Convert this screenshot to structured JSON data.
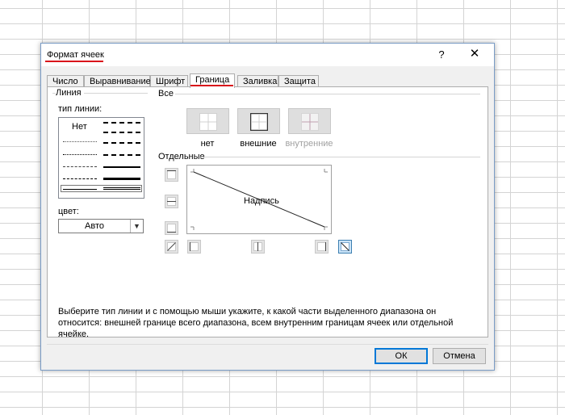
{
  "dialog": {
    "title": "Формат ячеек",
    "help_label": "?",
    "close_label": "✕"
  },
  "tabs": [
    {
      "label": "Число"
    },
    {
      "label": "Выравнивание"
    },
    {
      "label": "Шрифт"
    },
    {
      "label": "Граница"
    },
    {
      "label": "Заливка"
    },
    {
      "label": "Защита"
    }
  ],
  "active_tab": "Граница",
  "line": {
    "group_label": "Линия",
    "type_label": "тип линии:",
    "none_label": "Нет",
    "color_label": "цвет:",
    "color_value": "Авто"
  },
  "presets": {
    "group_label": "Все",
    "items": [
      {
        "label": "нет"
      },
      {
        "label": "внешние"
      },
      {
        "label": "внутренние"
      }
    ]
  },
  "separate": {
    "group_label": "Отдельные",
    "preview_text": "Надпись"
  },
  "hint": "Выберите тип линии и с помощью мыши укажите, к какой части выделенного диапазона он относится: внешней границе всего диапазона, всем внутренним границам ячеек или отдельной ячейке.",
  "buttons": {
    "ok": "ОК",
    "cancel": "Отмена"
  },
  "colors": {
    "accent_underline": "#d9141b",
    "focus_blue": "#0078d7"
  }
}
